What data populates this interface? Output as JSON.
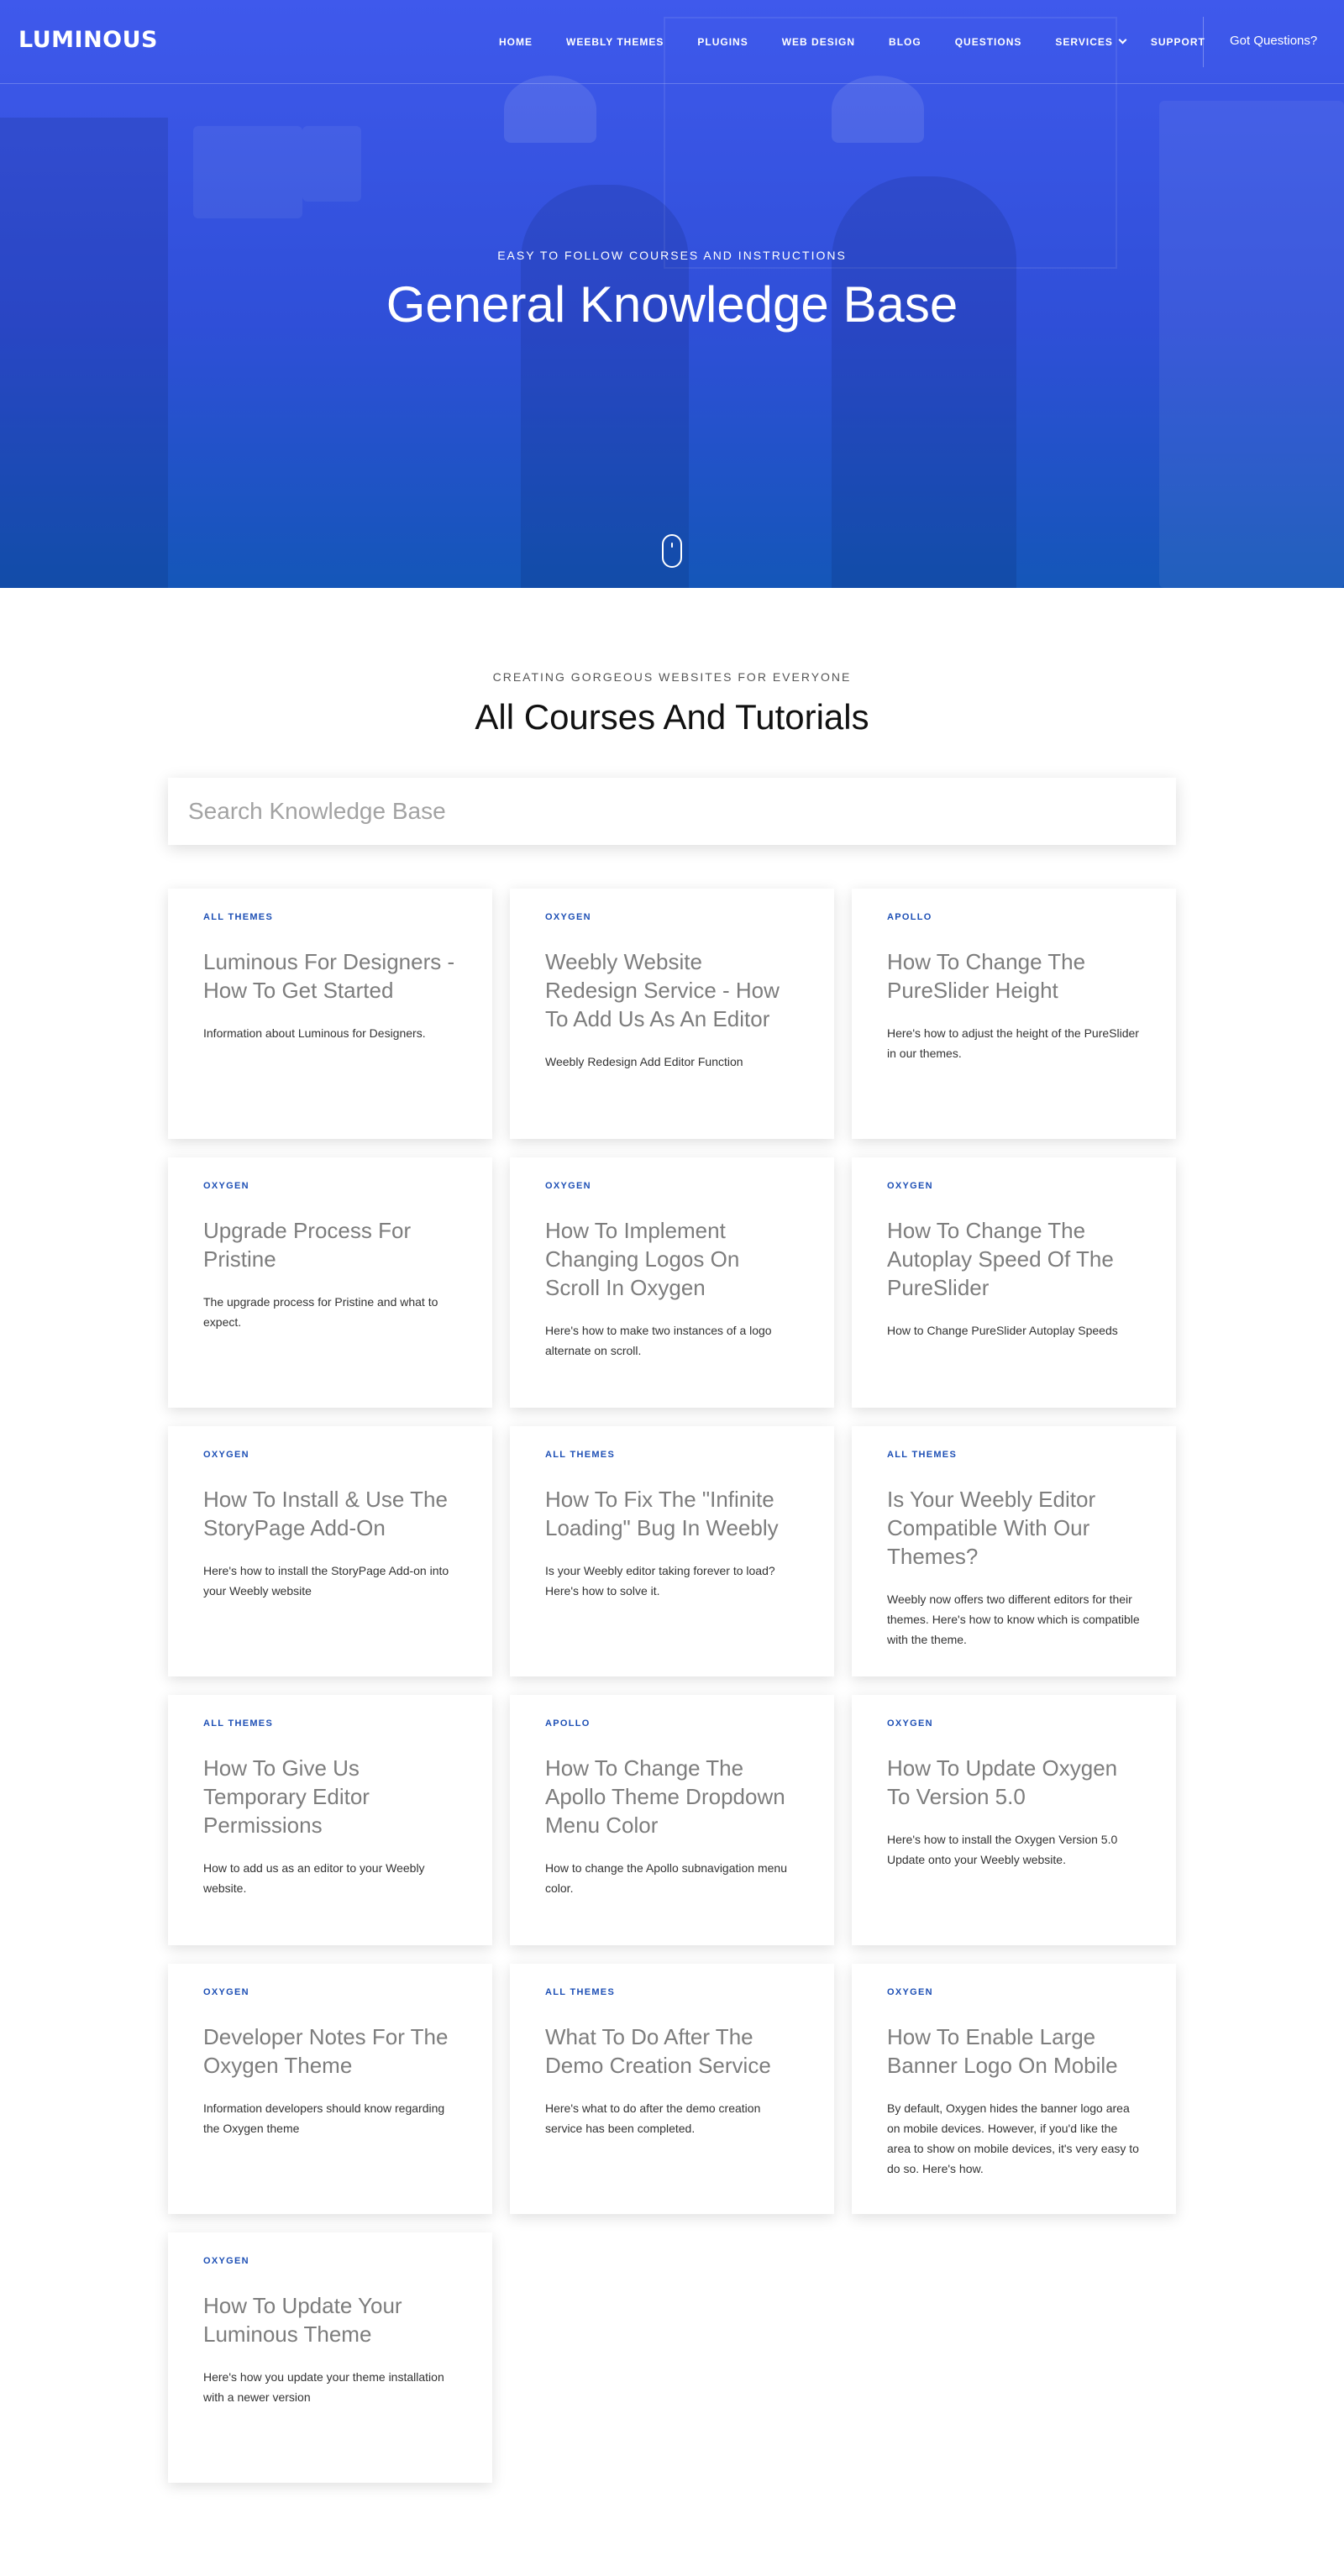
{
  "nav": {
    "logo": "LUMINOUS",
    "items": [
      "HOME",
      "WEEBLY THEMES",
      "PLUGINS",
      "WEB DESIGN",
      "BLOG",
      "QUESTIONS",
      "SERVICES",
      "SUPPORT"
    ],
    "cta": "Got Questions?"
  },
  "hero": {
    "kicker": "EASY TO FOLLOW COURSES AND INSTRUCTIONS",
    "title": "General Knowledge Base"
  },
  "section": {
    "kicker": "CREATING GORGEOUS WEBSITES FOR EVERYONE",
    "title": "All Courses And Tutorials",
    "search_placeholder": "Search Knowledge Base"
  },
  "cards": [
    {
      "tag": "ALL THEMES",
      "title": "Luminous For Designers - How To Get Started",
      "desc": "Information about Luminous for Designers."
    },
    {
      "tag": "OXYGEN",
      "title": "Weebly Website Redesign Service - How To Add Us As An Editor",
      "desc": "Weebly Redesign Add Editor Function"
    },
    {
      "tag": "APOLLO",
      "title": "How To Change The PureSlider Height",
      "desc": "Here's how to adjust the height of the PureSlider in our themes."
    },
    {
      "tag": "OXYGEN",
      "title": "Upgrade Process For Pristine",
      "desc": "The upgrade process for Pristine and what to expect."
    },
    {
      "tag": "OXYGEN",
      "title": "How To Implement Changing Logos On Scroll In Oxygen",
      "desc": "Here's how to make two instances of a logo alternate on scroll."
    },
    {
      "tag": "OXYGEN",
      "title": "How To Change The Autoplay Speed Of The PureSlider",
      "desc": "How to Change PureSlider Autoplay Speeds"
    },
    {
      "tag": "OXYGEN",
      "title": "How To Install & Use The StoryPage Add-On",
      "desc": "Here's how to install the StoryPage Add-on into your Weebly website"
    },
    {
      "tag": "ALL THEMES",
      "title": "How To Fix The \"Infinite Loading\" Bug In Weebly",
      "desc": "Is your Weebly editor taking forever to load? Here's how to solve it."
    },
    {
      "tag": "ALL THEMES",
      "title": "Is Your Weebly Editor Compatible With Our Themes?",
      "desc": "Weebly now offers two different editors for their themes. Here's how to know which is compatible with the theme."
    },
    {
      "tag": "ALL THEMES",
      "title": "How To Give Us Temporary Editor Permissions",
      "desc": "How to add us as an editor to your Weebly website."
    },
    {
      "tag": "APOLLO",
      "title": "How To Change The Apollo Theme Dropdown Menu Color",
      "desc": "How to change the Apollo subnavigation menu color."
    },
    {
      "tag": "OXYGEN",
      "title": "How To Update Oxygen To Version 5.0",
      "desc": "Here's how to install the Oxygen Version 5.0 Update onto your Weebly website."
    },
    {
      "tag": "OXYGEN",
      "title": "Developer Notes For The Oxygen Theme",
      "desc": "Information developers should know regarding the Oxygen theme"
    },
    {
      "tag": "ALL THEMES",
      "title": "What To Do After The Demo Creation Service",
      "desc": "Here's what to do after the demo creation service has been completed."
    },
    {
      "tag": "OXYGEN",
      "title": "How To Enable Large Banner Logo On Mobile",
      "desc": "By default, Oxygen hides the banner logo area on mobile devices. However, if you'd like the area to show on mobile devices, it's very easy to do so. Here's how."
    },
    {
      "tag": "OXYGEN",
      "title": "How To Update Your Luminous Theme",
      "desc": "Here's how you update your theme installation with a newer version"
    }
  ],
  "colors": {
    "hero_top": "#3f59ec",
    "hero_bottom": "#1456b8",
    "tag": "#1d4fb5",
    "card_title": "#7d7d7d"
  },
  "icons": {
    "scroll": "mouse-icon",
    "services_dropdown": "chevron-down-icon"
  }
}
